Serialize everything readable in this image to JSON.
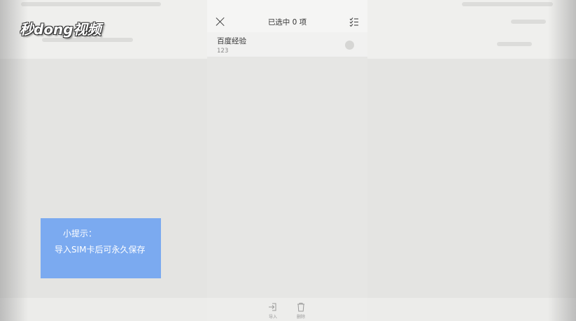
{
  "header": {
    "title": "已选中 0 项"
  },
  "contacts": [
    {
      "name": "百度经验",
      "number": "123"
    }
  ],
  "bottom_bar": {
    "actions": [
      {
        "label": "导入",
        "icon": "import-icon"
      },
      {
        "label": "删除",
        "icon": "delete-icon"
      }
    ]
  },
  "tip": {
    "title": "小提示：",
    "text": "导入SIM卡后可永久保存"
  },
  "watermark": {
    "logo_text": "秒dong视频"
  },
  "colors": {
    "tip_background": "#7baaf0",
    "page_background": "#e4e4e2"
  }
}
